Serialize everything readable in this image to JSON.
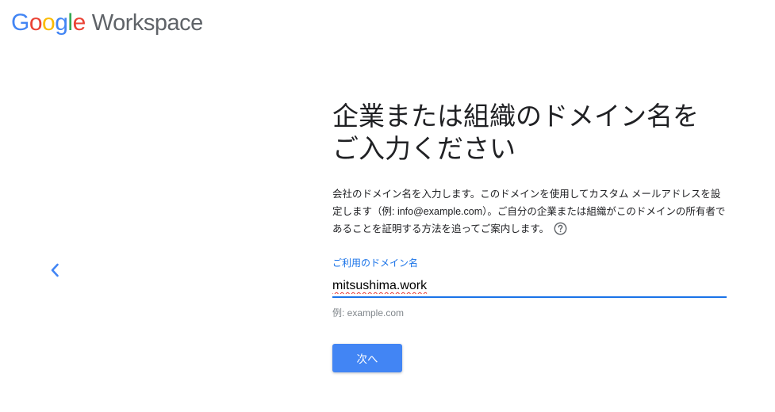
{
  "header": {
    "logo_letters": [
      {
        "char": "G",
        "color": "#4285F4"
      },
      {
        "char": "o",
        "color": "#EA4335"
      },
      {
        "char": "o",
        "color": "#FBBC05"
      },
      {
        "char": "g",
        "color": "#4285F4"
      },
      {
        "char": "l",
        "color": "#34A853"
      },
      {
        "char": "e",
        "color": "#EA4335"
      }
    ],
    "product_name": "Workspace"
  },
  "nav": {
    "back_icon": "chevron-left-icon",
    "back_color": "#4285F4"
  },
  "main": {
    "title": "企業または組織のドメイン名を\nご入力ください",
    "description": "会社のドメイン名を入力します。このドメインを使用してカスタム メールアドレスを設定します（例: info@example.com）。ご自分の企業または組織がこのドメインの所有者であることを証明する方法を追ってご案内します。",
    "help_icon": "help-circle-icon",
    "field": {
      "label": "ご利用のドメイン名",
      "value": "mitsushima.work",
      "hint": "例: example.com"
    },
    "next_label": "次へ"
  },
  "colors": {
    "accent": "#1A73E8",
    "button": "#4285F4",
    "spellcheck": "#E53935"
  }
}
